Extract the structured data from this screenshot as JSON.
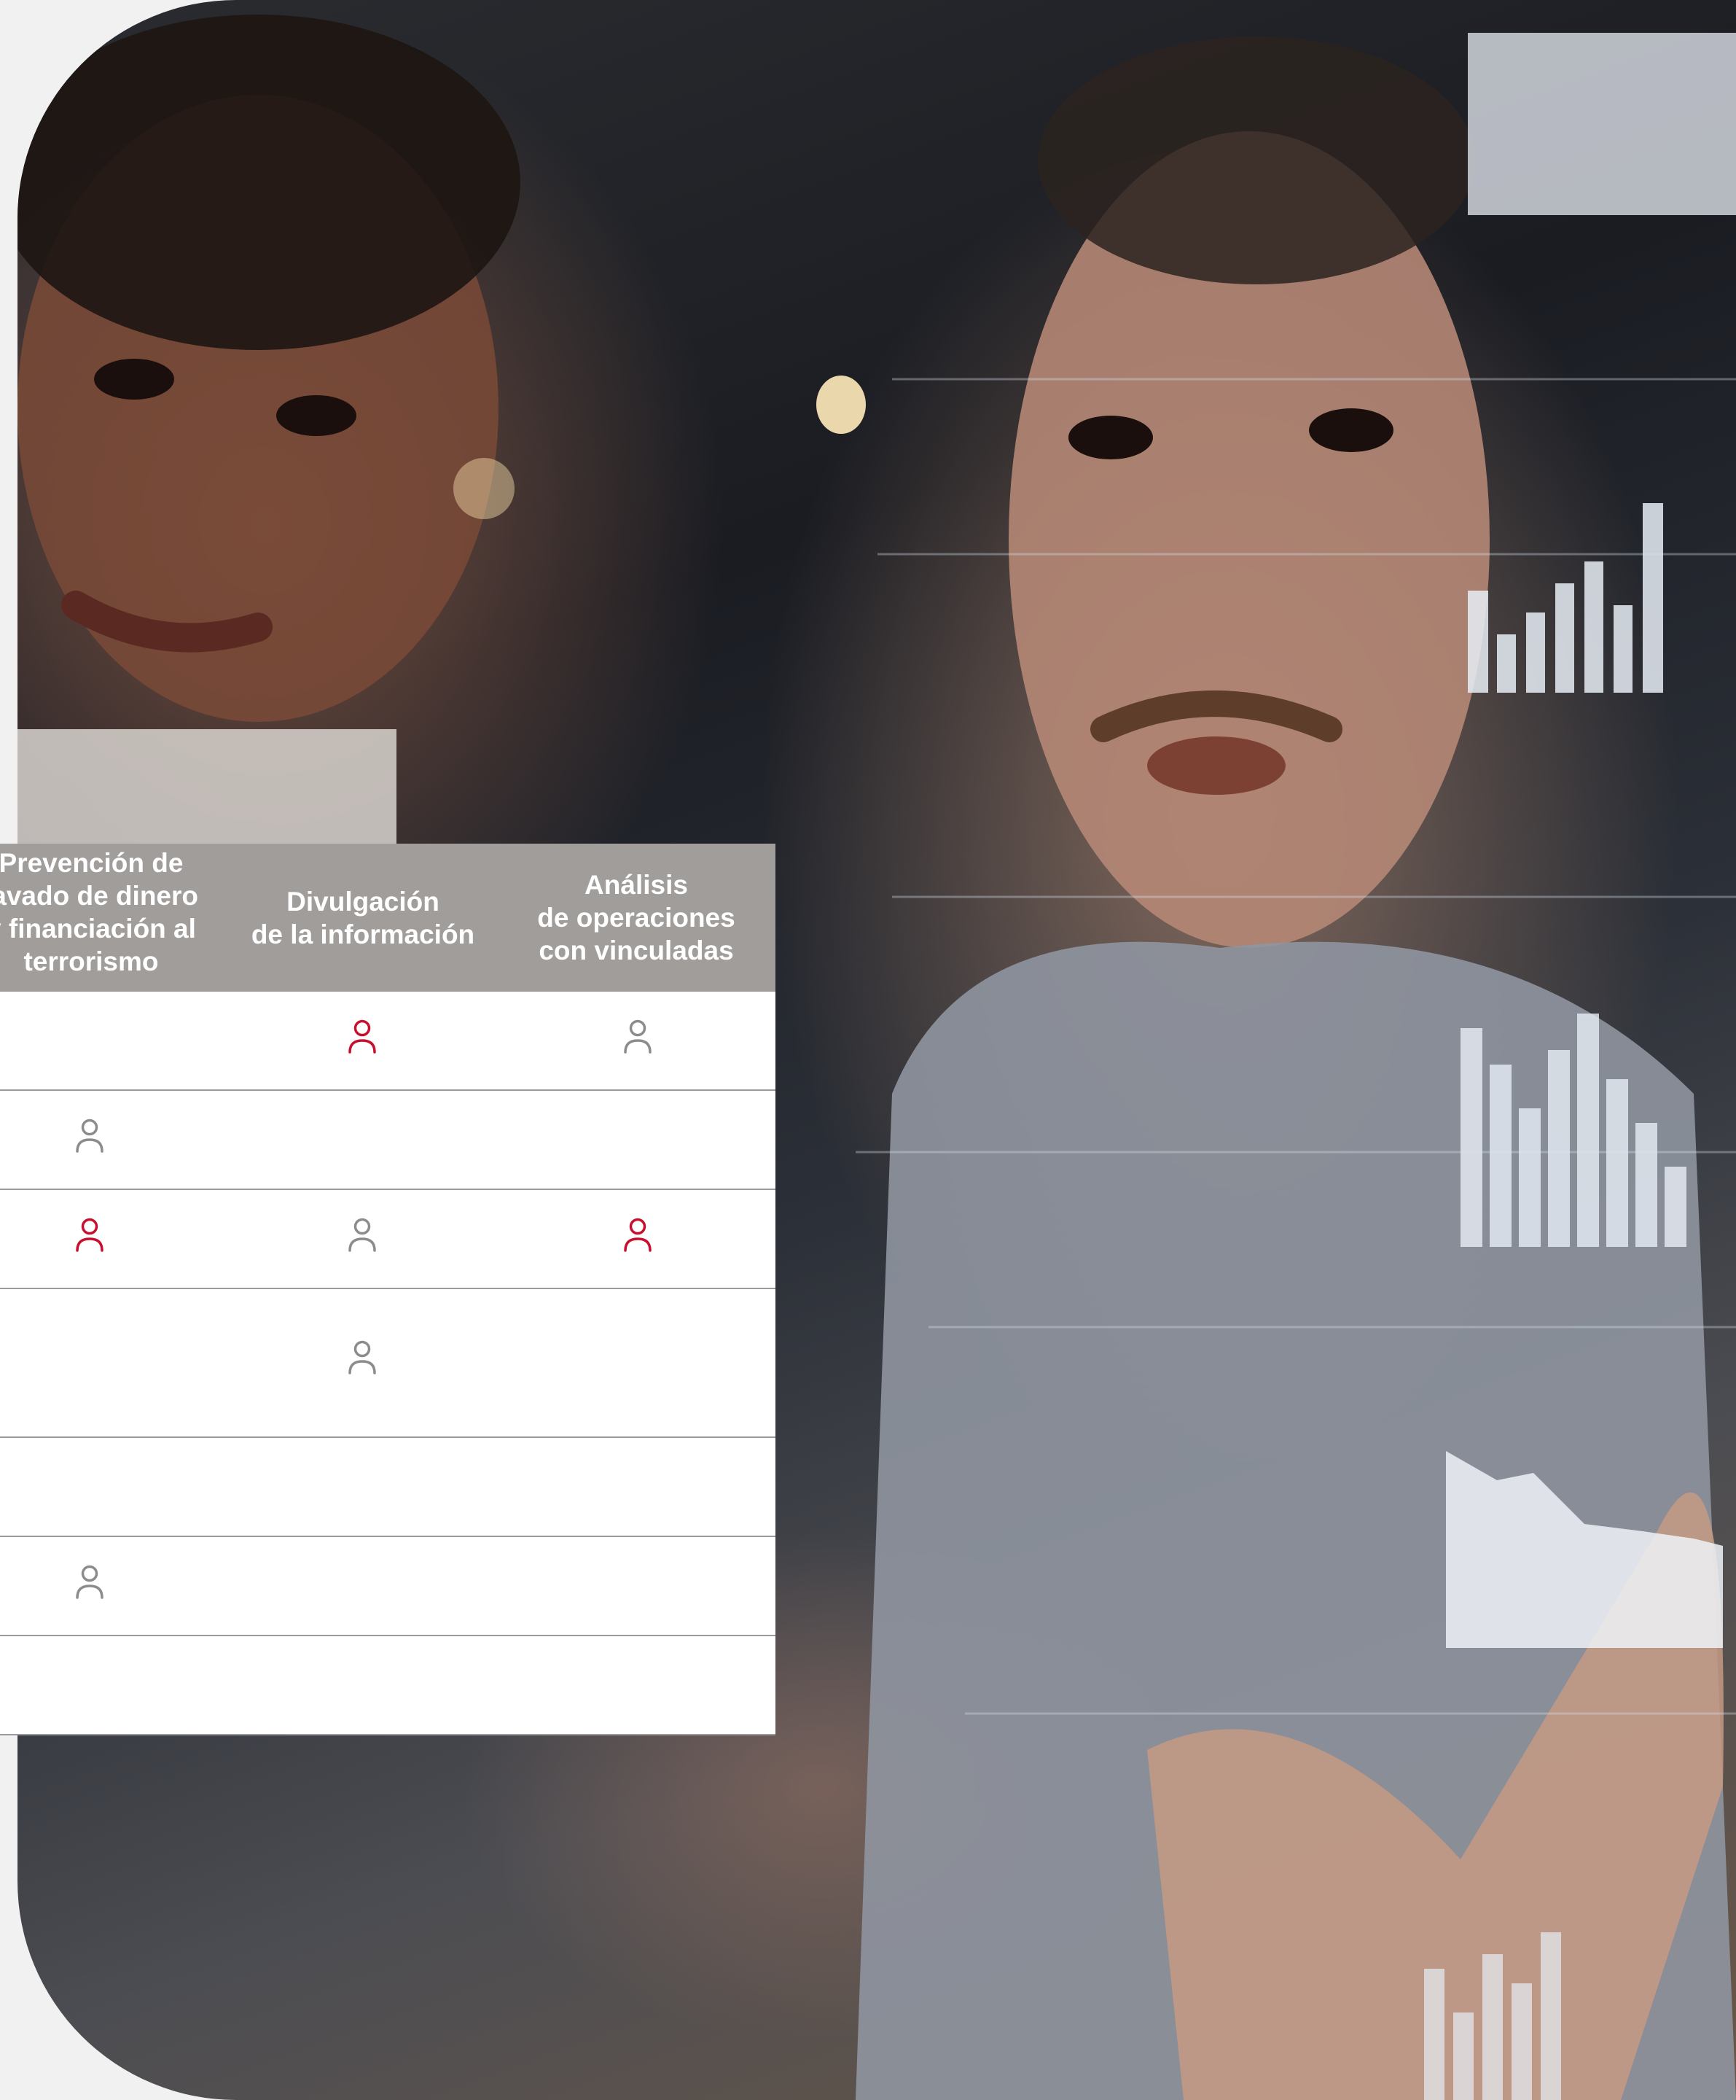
{
  "table": {
    "columns": [
      "Prevención de\nlavado de dinero\ny financiación al\nterrorismo",
      "Divulgación\nde la información",
      "Análisis\nde operaciones\ncon vinculadas"
    ],
    "rows": [
      [
        "",
        "person-icon-red",
        "person-icon-gray"
      ],
      [
        "person-icon-gray",
        "",
        ""
      ],
      [
        "person-icon-red",
        "person-icon-gray",
        "person-icon-red"
      ],
      [
        "",
        "person-icon-gray",
        ""
      ],
      [
        "",
        "",
        ""
      ],
      [
        "person-icon-gray",
        "",
        ""
      ],
      [
        "",
        "",
        ""
      ]
    ]
  },
  "colors": {
    "header_bg": "#a19d9b",
    "icon_red": "#c8102e",
    "icon_gray": "#8c8c8c",
    "row_divider": "#9b9b9b"
  }
}
